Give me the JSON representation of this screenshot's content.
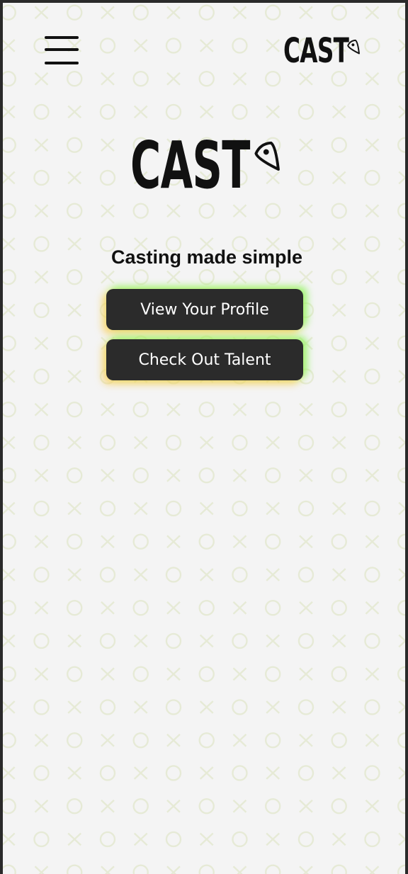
{
  "header": {
    "menu_icon": "hamburger-menu-icon",
    "logo_text": "CAST",
    "logo_icon": "guitar-pick-icon"
  },
  "hero": {
    "logo_text": "CAST",
    "logo_icon": "guitar-pick-icon",
    "tagline": "Casting made simple"
  },
  "actions": {
    "view_profile_label": "View Your Profile",
    "check_talent_label": "Check Out Talent"
  },
  "colors": {
    "background": "#f4f4f4",
    "pattern": "#e6ead6",
    "button": "#2b2b2b",
    "button_text": "#ffffff",
    "glow_green": "#7cf450",
    "glow_yellow": "#ffc446",
    "text": "#111111"
  }
}
